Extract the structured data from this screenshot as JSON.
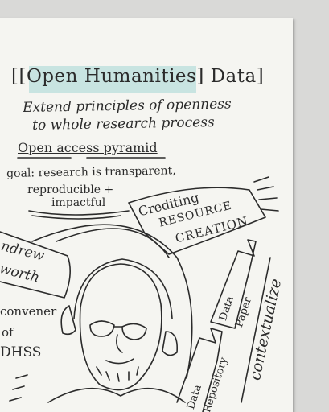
{
  "sketch": {
    "title": "[[Open Humanities] Data]",
    "subtitle_line1": "Extend principles of openness",
    "subtitle_line2": "to whole research process",
    "pyramid_label": "Open access pyramid",
    "goal_line1": "goal: research is transparent,",
    "goal_line2": "reproducible +",
    "goal_line3": "impactful",
    "crediting_line1": "Crediting",
    "crediting_line2": "RESOURCE",
    "crediting_line3": "CREATION",
    "name_line1": "ndrew",
    "name_line2": "worth",
    "convener_line1": "convener",
    "convener_line2": "of",
    "convener_line3": "DHSS",
    "data_paper_line1": "Data",
    "data_paper_line2": "Paper",
    "data_repo_line1": "Data",
    "data_repo_line2": "Repository",
    "contextualize": "contextualize"
  },
  "colors": {
    "paper": "#f5f5f1",
    "background": "#d9d9d7",
    "ink": "#2b2b2b",
    "highlight": "#bfe0de"
  }
}
